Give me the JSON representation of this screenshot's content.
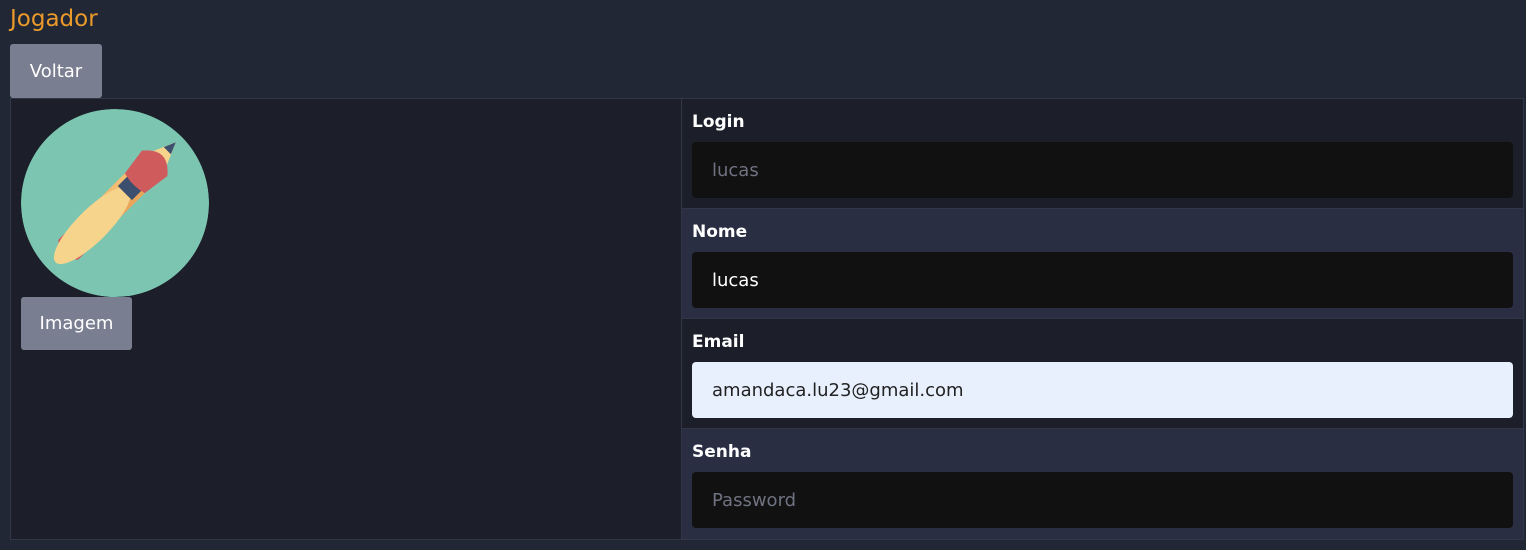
{
  "page": {
    "title": "Jogador",
    "back_label": "Voltar"
  },
  "avatar": {
    "icon": "pencil-and-brush-icon",
    "image_button_label": "Imagem",
    "colors": {
      "circle": "#7cc5b1",
      "pencil": "#e9a55a",
      "brush": "#f6d48c",
      "eraser": "#d05b5c",
      "ferrule": "#3d4f6e"
    }
  },
  "form": {
    "login": {
      "label": "Login",
      "value": "lucas"
    },
    "nome": {
      "label": "Nome",
      "value": "lucas"
    },
    "email": {
      "label": "Email",
      "value": "amandaca.lu23@gmail.com"
    },
    "senha": {
      "label": "Senha",
      "placeholder": "Password"
    }
  },
  "colors": {
    "title": "#e99a2a",
    "background": "#222736",
    "button": "#7a7e91",
    "input": "#111111",
    "autofill_input": "#e8f0fe"
  }
}
